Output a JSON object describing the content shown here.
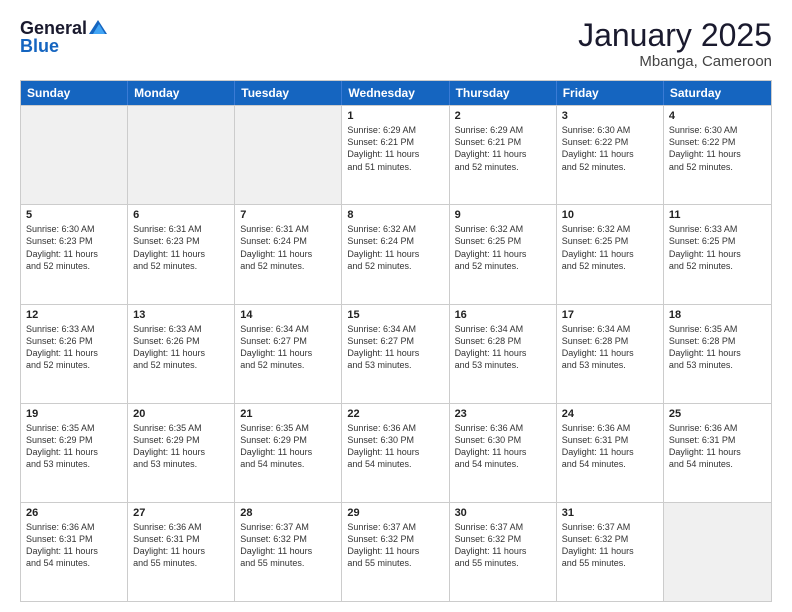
{
  "header": {
    "logo_line1": "General",
    "logo_line2": "Blue",
    "month": "January 2025",
    "location": "Mbanga, Cameroon"
  },
  "weekdays": [
    "Sunday",
    "Monday",
    "Tuesday",
    "Wednesday",
    "Thursday",
    "Friday",
    "Saturday"
  ],
  "weeks": [
    [
      {
        "day": "",
        "info": "",
        "shaded": true
      },
      {
        "day": "",
        "info": "",
        "shaded": true
      },
      {
        "day": "",
        "info": "",
        "shaded": true
      },
      {
        "day": "1",
        "info": "Sunrise: 6:29 AM\nSunset: 6:21 PM\nDaylight: 11 hours\nand 51 minutes.",
        "shaded": false
      },
      {
        "day": "2",
        "info": "Sunrise: 6:29 AM\nSunset: 6:21 PM\nDaylight: 11 hours\nand 52 minutes.",
        "shaded": false
      },
      {
        "day": "3",
        "info": "Sunrise: 6:30 AM\nSunset: 6:22 PM\nDaylight: 11 hours\nand 52 minutes.",
        "shaded": false
      },
      {
        "day": "4",
        "info": "Sunrise: 6:30 AM\nSunset: 6:22 PM\nDaylight: 11 hours\nand 52 minutes.",
        "shaded": false
      }
    ],
    [
      {
        "day": "5",
        "info": "Sunrise: 6:30 AM\nSunset: 6:23 PM\nDaylight: 11 hours\nand 52 minutes.",
        "shaded": false
      },
      {
        "day": "6",
        "info": "Sunrise: 6:31 AM\nSunset: 6:23 PM\nDaylight: 11 hours\nand 52 minutes.",
        "shaded": false
      },
      {
        "day": "7",
        "info": "Sunrise: 6:31 AM\nSunset: 6:24 PM\nDaylight: 11 hours\nand 52 minutes.",
        "shaded": false
      },
      {
        "day": "8",
        "info": "Sunrise: 6:32 AM\nSunset: 6:24 PM\nDaylight: 11 hours\nand 52 minutes.",
        "shaded": false
      },
      {
        "day": "9",
        "info": "Sunrise: 6:32 AM\nSunset: 6:25 PM\nDaylight: 11 hours\nand 52 minutes.",
        "shaded": false
      },
      {
        "day": "10",
        "info": "Sunrise: 6:32 AM\nSunset: 6:25 PM\nDaylight: 11 hours\nand 52 minutes.",
        "shaded": false
      },
      {
        "day": "11",
        "info": "Sunrise: 6:33 AM\nSunset: 6:25 PM\nDaylight: 11 hours\nand 52 minutes.",
        "shaded": false
      }
    ],
    [
      {
        "day": "12",
        "info": "Sunrise: 6:33 AM\nSunset: 6:26 PM\nDaylight: 11 hours\nand 52 minutes.",
        "shaded": false
      },
      {
        "day": "13",
        "info": "Sunrise: 6:33 AM\nSunset: 6:26 PM\nDaylight: 11 hours\nand 52 minutes.",
        "shaded": false
      },
      {
        "day": "14",
        "info": "Sunrise: 6:34 AM\nSunset: 6:27 PM\nDaylight: 11 hours\nand 52 minutes.",
        "shaded": false
      },
      {
        "day": "15",
        "info": "Sunrise: 6:34 AM\nSunset: 6:27 PM\nDaylight: 11 hours\nand 53 minutes.",
        "shaded": false
      },
      {
        "day": "16",
        "info": "Sunrise: 6:34 AM\nSunset: 6:28 PM\nDaylight: 11 hours\nand 53 minutes.",
        "shaded": false
      },
      {
        "day": "17",
        "info": "Sunrise: 6:34 AM\nSunset: 6:28 PM\nDaylight: 11 hours\nand 53 minutes.",
        "shaded": false
      },
      {
        "day": "18",
        "info": "Sunrise: 6:35 AM\nSunset: 6:28 PM\nDaylight: 11 hours\nand 53 minutes.",
        "shaded": false
      }
    ],
    [
      {
        "day": "19",
        "info": "Sunrise: 6:35 AM\nSunset: 6:29 PM\nDaylight: 11 hours\nand 53 minutes.",
        "shaded": false
      },
      {
        "day": "20",
        "info": "Sunrise: 6:35 AM\nSunset: 6:29 PM\nDaylight: 11 hours\nand 53 minutes.",
        "shaded": false
      },
      {
        "day": "21",
        "info": "Sunrise: 6:35 AM\nSunset: 6:29 PM\nDaylight: 11 hours\nand 54 minutes.",
        "shaded": false
      },
      {
        "day": "22",
        "info": "Sunrise: 6:36 AM\nSunset: 6:30 PM\nDaylight: 11 hours\nand 54 minutes.",
        "shaded": false
      },
      {
        "day": "23",
        "info": "Sunrise: 6:36 AM\nSunset: 6:30 PM\nDaylight: 11 hours\nand 54 minutes.",
        "shaded": false
      },
      {
        "day": "24",
        "info": "Sunrise: 6:36 AM\nSunset: 6:31 PM\nDaylight: 11 hours\nand 54 minutes.",
        "shaded": false
      },
      {
        "day": "25",
        "info": "Sunrise: 6:36 AM\nSunset: 6:31 PM\nDaylight: 11 hours\nand 54 minutes.",
        "shaded": false
      }
    ],
    [
      {
        "day": "26",
        "info": "Sunrise: 6:36 AM\nSunset: 6:31 PM\nDaylight: 11 hours\nand 54 minutes.",
        "shaded": false
      },
      {
        "day": "27",
        "info": "Sunrise: 6:36 AM\nSunset: 6:31 PM\nDaylight: 11 hours\nand 55 minutes.",
        "shaded": false
      },
      {
        "day": "28",
        "info": "Sunrise: 6:37 AM\nSunset: 6:32 PM\nDaylight: 11 hours\nand 55 minutes.",
        "shaded": false
      },
      {
        "day": "29",
        "info": "Sunrise: 6:37 AM\nSunset: 6:32 PM\nDaylight: 11 hours\nand 55 minutes.",
        "shaded": false
      },
      {
        "day": "30",
        "info": "Sunrise: 6:37 AM\nSunset: 6:32 PM\nDaylight: 11 hours\nand 55 minutes.",
        "shaded": false
      },
      {
        "day": "31",
        "info": "Sunrise: 6:37 AM\nSunset: 6:32 PM\nDaylight: 11 hours\nand 55 minutes.",
        "shaded": false
      },
      {
        "day": "",
        "info": "",
        "shaded": true
      }
    ]
  ]
}
